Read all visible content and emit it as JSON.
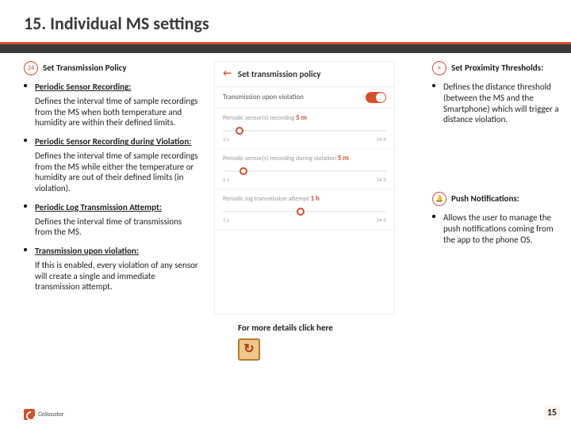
{
  "header": {
    "title": "15. Individual MS settings"
  },
  "left": {
    "section": {
      "label": "Set Transmission Policy",
      "icon": "clock-24-icon"
    },
    "items": [
      {
        "heading": "Periodic Sensor Recording:",
        "body": "Defines the interval time of sample recordings from the MS when both temperature and humidity are within their defined limits."
      },
      {
        "heading": "Periodic Sensor Recording during Violation:",
        "body": "Defines the interval time of sample recordings from the MS while either the temperature or humidity are out of their defined limits (in violation)."
      },
      {
        "heading": "Periodic Log Transmission Attempt:",
        "body": "Defines the interval time of transmissions from the MS."
      },
      {
        "heading": "Transmission upon violation:",
        "body": "If this is enabled, every violation of any sensor will create a single and immediate transmission attempt."
      }
    ]
  },
  "right": {
    "section1": {
      "label": "Set Proximity Thresholds:",
      "icon": "sliders-icon"
    },
    "item1": {
      "body": "Defines the distance threshold (between the MS and the Smartphone) which will trigger a distance violation."
    },
    "section2": {
      "label": "Push Notifications:",
      "icon": "bell-icon"
    },
    "item2": {
      "body": "Allows the user to manage the push notifications coming from the app to the phone OS."
    }
  },
  "phone": {
    "screen_title": "Set transmission policy",
    "toggle_row": "Transmission upon violation",
    "sections": [
      {
        "label": "Periodic sensor(s) recording",
        "value": "5 m",
        "min": "5 s",
        "max": "24 h",
        "knob_pct": 8
      },
      {
        "label": "Periodic sensor(s) recording during violation",
        "value": "5 m",
        "min": "5 s",
        "max": "24 h",
        "knob_pct": 10
      },
      {
        "label": "Periodic log transmission attempt",
        "value": "1 h",
        "min": "5 s",
        "max": "24 h",
        "knob_pct": 45
      }
    ]
  },
  "link": {
    "text": "For more details click here",
    "icon": "reload-icon"
  },
  "footer": {
    "brand": "Cellocator",
    "page": "15"
  }
}
